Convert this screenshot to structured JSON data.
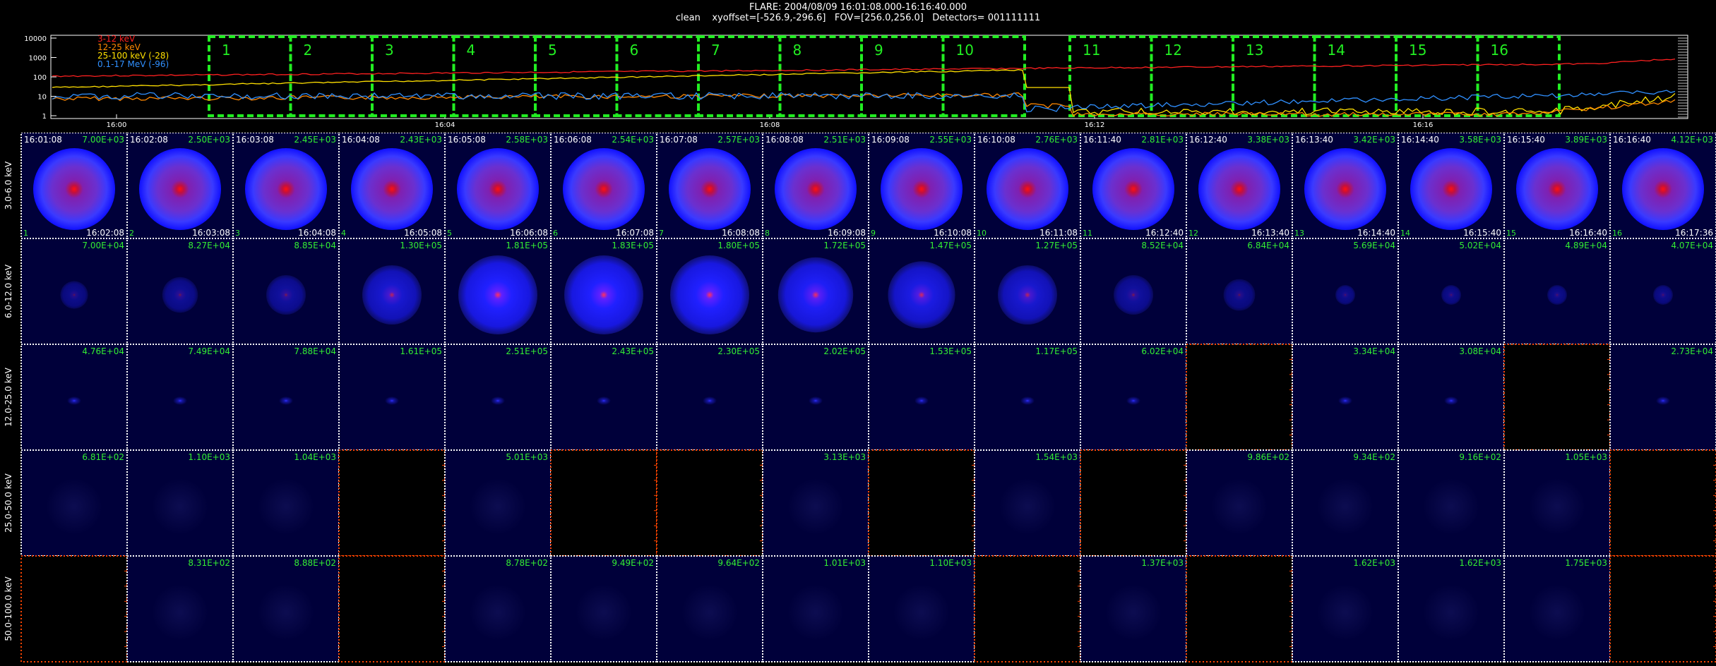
{
  "header": {
    "line1": "FLARE: 2004/08/09 16:01:08.000-16:16:40.000",
    "line2": "clean    xyoffset=[-526.9,-296.6]   FOV=[256.0,256.0]   Detectors= 001111111"
  },
  "lightcurve": {
    "y_ticks": [
      "10000",
      "1000",
      "100",
      "10",
      "1"
    ],
    "x_ticks": [
      "16:00",
      "16:04",
      "16:08",
      "16:12",
      "16:16"
    ],
    "legend": [
      {
        "label": "3-12 keV",
        "color": "#ff2020"
      },
      {
        "label": "12-25 keV",
        "color": "#ff8800"
      },
      {
        "label": "25-100 keV (-28)",
        "color": "#ffe000"
      },
      {
        "label": "0.1-17 MeV (-96)",
        "color": "#3090ff"
      }
    ],
    "interval_numbers": [
      "1",
      "2",
      "3",
      "4",
      "5",
      "6",
      "7",
      "8",
      "9",
      "10",
      "11",
      "12",
      "13",
      "14",
      "15",
      "16"
    ],
    "interval_color": "#22ee22"
  },
  "grid": {
    "rows": [
      {
        "label": "3.0-6.0 keV",
        "maxima": [
          "7.00E+03",
          "2.50E+03",
          "2.45E+03",
          "2.43E+03",
          "2.58E+03",
          "2.54E+03",
          "2.57E+03",
          "2.51E+03",
          "2.55E+03",
          "2.76E+03",
          "2.81E+03",
          "3.38E+03",
          "3.42E+03",
          "3.58E+03",
          "3.89E+03",
          "4.12E+03"
        ]
      },
      {
        "label": "6.0-12.0 keV",
        "maxima": [
          "7.00E+04",
          "8.27E+04",
          "8.85E+04",
          "1.30E+05",
          "1.81E+05",
          "1.83E+05",
          "1.80E+05",
          "1.72E+05",
          "1.47E+05",
          "1.27E+05",
          "8.52E+04",
          "6.84E+04",
          "5.69E+04",
          "5.02E+04",
          "4.89E+04",
          "4.07E+04"
        ]
      },
      {
        "label": "12.0-25.0 keV",
        "maxima": [
          "4.76E+04",
          "7.49E+04",
          "7.88E+04",
          "1.61E+05",
          "2.51E+05",
          "2.43E+05",
          "2.30E+05",
          "2.02E+05",
          "1.53E+05",
          "1.17E+05",
          "6.02E+04",
          "",
          "3.34E+04",
          "3.08E+04",
          "",
          "2.73E+04"
        ]
      },
      {
        "label": "25.0-50.0 keV",
        "maxima": [
          "6.81E+02",
          "1.10E+03",
          "1.04E+03",
          "",
          "5.01E+03",
          "",
          "",
          "3.13E+03",
          "",
          "1.54E+03",
          "",
          "9.86E+02",
          "9.34E+02",
          "9.16E+02",
          "1.05E+03",
          ""
        ]
      },
      {
        "label": "50.0-100.0 keV",
        "maxima": [
          "",
          "8.31E+02",
          "8.88E+02",
          "",
          "8.78E+02",
          "9.49E+02",
          "9.64E+02",
          "1.01E+03",
          "1.10E+03",
          "",
          "1.37E+03",
          "",
          "1.62E+03",
          "1.62E+03",
          "1.75E+03",
          ""
        ]
      }
    ],
    "start_times": [
      "16:01:08",
      "16:02:08",
      "16:03:08",
      "16:04:08",
      "16:05:08",
      "16:06:08",
      "16:07:08",
      "16:08:08",
      "16:09:08",
      "16:10:08",
      "16:11:40",
      "16:12:40",
      "16:13:40",
      "16:14:40",
      "16:15:40",
      "16:16:40"
    ],
    "end_times": [
      "16:02:08",
      "16:03:08",
      "16:04:08",
      "16:05:08",
      "16:06:08",
      "16:07:08",
      "16:08:08",
      "16:09:08",
      "16:10:08",
      "16:11:08",
      "16:12:40",
      "16:13:40",
      "16:14:40",
      "16:15:40",
      "16:16:40",
      "16:17:36"
    ],
    "cell_numbers": [
      "1",
      "2",
      "3",
      "4",
      "5",
      "6",
      "7",
      "8",
      "9",
      "10",
      "11",
      "12",
      "13",
      "14",
      "15",
      "16"
    ],
    "empty_cells": [
      [
        2,
        11
      ],
      [
        2,
        14
      ],
      [
        3,
        3
      ],
      [
        3,
        5
      ],
      [
        3,
        6
      ],
      [
        3,
        8
      ],
      [
        3,
        10
      ],
      [
        3,
        15
      ],
      [
        4,
        0
      ],
      [
        4,
        3
      ],
      [
        4,
        9
      ],
      [
        4,
        11
      ],
      [
        4,
        15
      ]
    ],
    "colors": {
      "value_text": "#33ee33",
      "time_text": "#ffffff",
      "cell_border": "#ffffff",
      "empty_border": "#ff4400",
      "cell_bg": "#00003a"
    }
  }
}
